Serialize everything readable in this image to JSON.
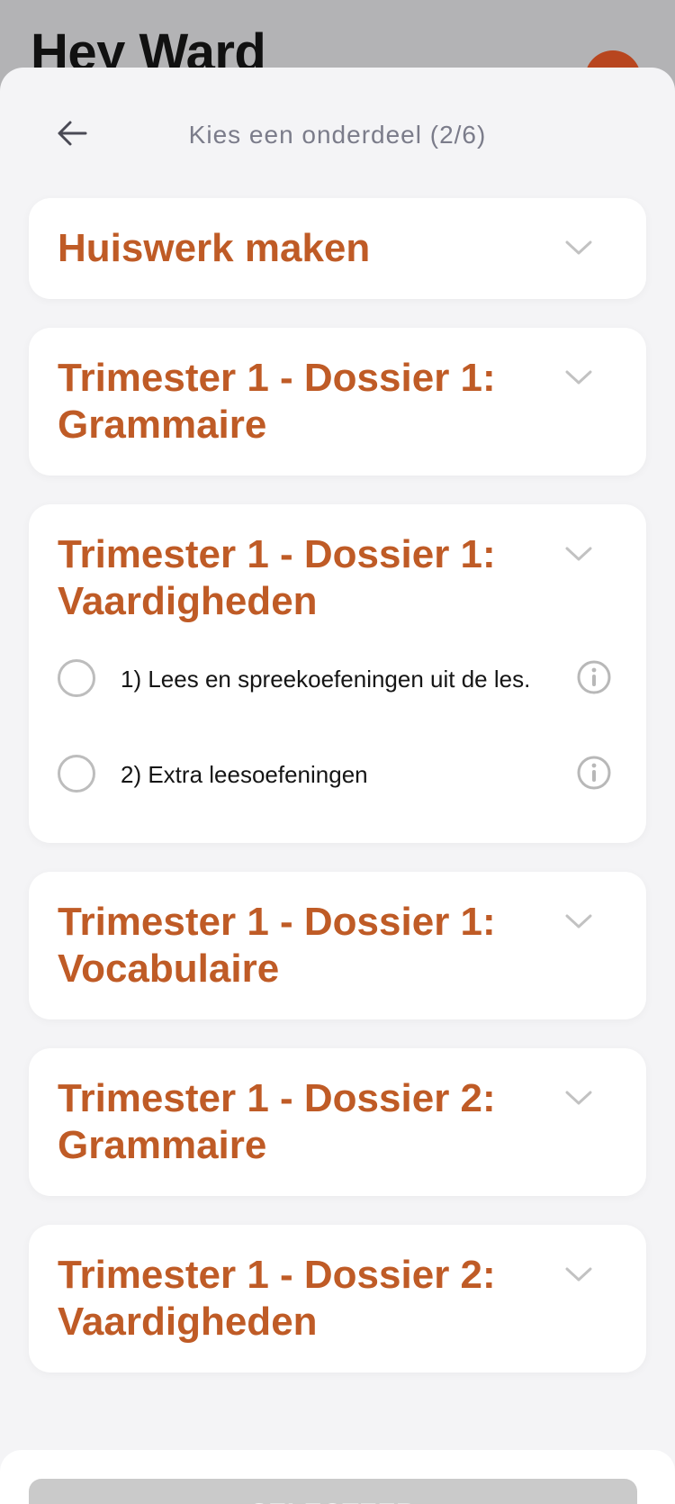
{
  "backdrop": {
    "greeting": "Hey Ward"
  },
  "sheet": {
    "title": "Kies een onderdeel (2/6)",
    "back_icon": "arrow-left-icon"
  },
  "sections": [
    {
      "title": "Huiswerk maken",
      "expanded": false
    },
    {
      "title": "Trimester 1 - Dossier 1: Grammaire",
      "expanded": false
    },
    {
      "title": "Trimester 1 - Dossier 1: Vaardigheden",
      "expanded": true,
      "options": [
        {
          "label": "1) Lees en spreekoefeningen uit de les.",
          "selected": false
        },
        {
          "label": "2) Extra leesoefeningen",
          "selected": false
        }
      ]
    },
    {
      "title": "Trimester 1 - Dossier 1: Vocabulaire",
      "expanded": false
    },
    {
      "title": "Trimester 1 - Dossier 2: Grammaire",
      "expanded": false
    },
    {
      "title": "Trimester 1 - Dossier 2: Vaardigheden",
      "expanded": false
    }
  ],
  "footer": {
    "select_label": "SELECTEER",
    "select_enabled": false
  },
  "colors": {
    "accent": "#bf5b26",
    "disabled_button": "#cacaca",
    "sheet_background": "#f4f4f6",
    "overlay": "#b3b3b5"
  }
}
